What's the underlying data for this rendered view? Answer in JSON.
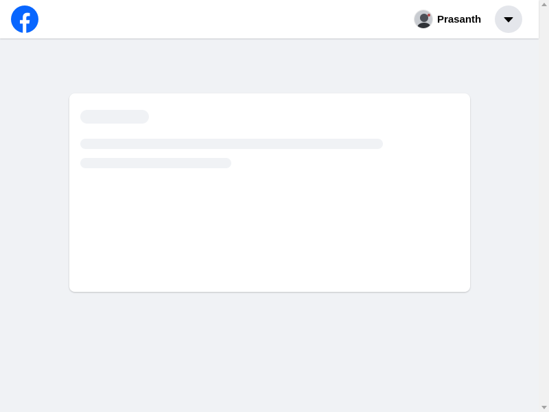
{
  "header": {
    "logo_icon": "facebook-logo-icon",
    "profile": {
      "name": "Prasanth",
      "avatar_icon": "user-avatar"
    },
    "account_menu_icon": "caret-down-icon"
  },
  "content": {
    "loading_placeholder_lines": 3
  },
  "colors": {
    "brand": "#0866ff",
    "page_background": "#f0f2f5",
    "card_background": "#ffffff",
    "skeleton": "#f0f2f5",
    "button_background": "#e4e6eb",
    "text_primary": "#050505"
  }
}
